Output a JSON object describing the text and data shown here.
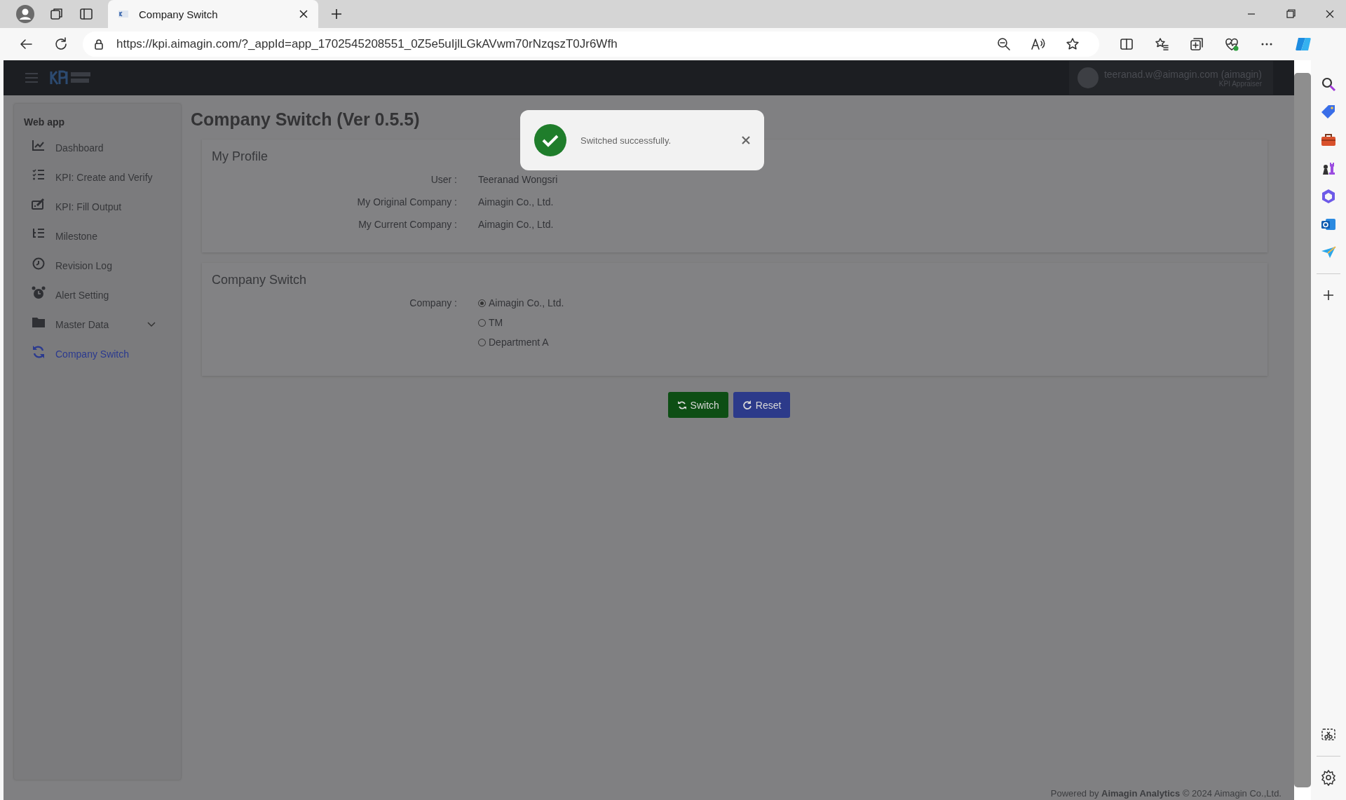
{
  "browser": {
    "tab_title": "Company Switch",
    "url": "https://kpi.aimagin.com/?_appId=app_1702545208551_0Z5e5uIjlLGkAVwm70rNzqszT0Jr6Wfh"
  },
  "app_header": {
    "user": "teeranad.w@aimagin.com (aimagin)",
    "role": "KPI Appraiser"
  },
  "sidebar": {
    "section": "Web app",
    "items": [
      {
        "label": "Dashboard",
        "selected": false,
        "kind": "link"
      },
      {
        "label": "KPI: Create and Verify",
        "selected": false,
        "kind": "link"
      },
      {
        "label": "KPI: Fill Output",
        "selected": false,
        "kind": "link"
      },
      {
        "label": "Milestone",
        "selected": false,
        "kind": "link"
      },
      {
        "label": "Revision Log",
        "selected": false,
        "kind": "link"
      },
      {
        "label": "Alert Setting",
        "selected": false,
        "kind": "link"
      },
      {
        "label": "Master Data",
        "selected": false,
        "kind": "group"
      },
      {
        "label": "Company Switch",
        "selected": true,
        "kind": "link"
      }
    ]
  },
  "page_title": "Company Switch (Ver 0.5.5)",
  "profile": {
    "title": "My Profile",
    "fields": [
      {
        "label": "User :",
        "value": "Teeranad Wongsri"
      },
      {
        "label": "My Original Company :",
        "value": "Aimagin Co., Ltd."
      },
      {
        "label": "My Current Company :",
        "value": "Aimagin Co., Ltd."
      }
    ]
  },
  "company_switch": {
    "title": "Company Switch",
    "label": "Company :",
    "options": [
      {
        "label": "Aimagin Co., Ltd.",
        "selected": true
      },
      {
        "label": "TM",
        "selected": false
      },
      {
        "label": "Department A",
        "selected": false
      }
    ]
  },
  "buttons": [
    {
      "label": "Switch",
      "kind": "primary"
    },
    {
      "label": "Reset",
      "kind": "secondary"
    }
  ],
  "toast": {
    "message": "Switched successfully."
  },
  "footer": "Powered by **Aimagin Analytics** © 2024 Aimagin Co.,Ltd."
}
